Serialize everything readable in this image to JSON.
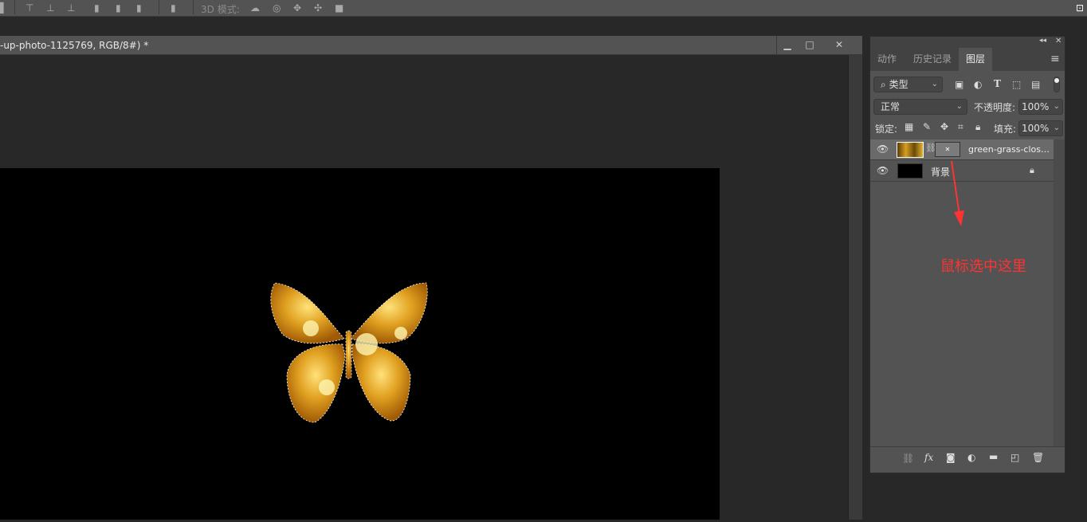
{
  "optionsbar": {
    "mode_label": "3D 模式:"
  },
  "document": {
    "title": "-up-photo-1125769, RGB/8#) *",
    "minimize": "▁",
    "maximize": "□",
    "close": "✕"
  },
  "panel": {
    "collapse": "◂◂",
    "close": "✕",
    "tabs": [
      {
        "label": "动作"
      },
      {
        "label": "历史记录"
      },
      {
        "label": "图层"
      }
    ],
    "menu": "≡",
    "filter": {
      "label": "类型",
      "search_icon": "⌕"
    },
    "blend_mode": "正常",
    "opacity_label": "不透明度:",
    "opacity_value": "100%",
    "lock_label": "锁定:",
    "fill_label": "填充:",
    "fill_value": "100%",
    "layers": [
      {
        "name": "green-grass-clos…",
        "visible": true,
        "selected": true
      },
      {
        "name": "背景",
        "visible": true,
        "locked": true
      }
    ]
  },
  "annotation": {
    "text": "鼠标选中这里",
    "color": "#ff3333"
  }
}
